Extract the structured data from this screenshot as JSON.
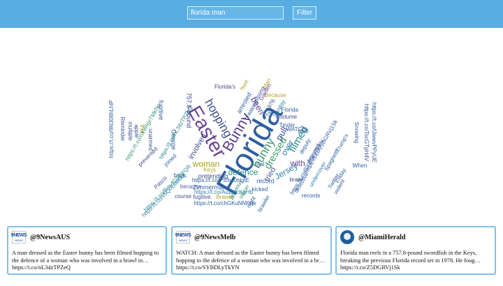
{
  "header": {
    "search_value": "florida man",
    "filter_label": "Filter",
    "bar_color": "#58aee3"
  },
  "word_cloud": {
    "words": [
      {
        "text": "Florida",
        "color": "#2f5fa0"
      },
      {
        "text": "Easter",
        "color": "#6a4495"
      },
      {
        "text": "Bunny",
        "color": "#5a3c8e"
      },
      {
        "text": "hopping",
        "color": "#3d4f8f"
      },
      {
        "text": "bunny",
        "color": "#3b9a6e"
      },
      {
        "text": "woman",
        "color": "#a1a11c"
      },
      {
        "text": "defence",
        "color": "#2a8a87"
      },
      {
        "text": "Jersey",
        "color": "#2f7fa8"
      },
      {
        "text": "filmed",
        "color": "#2a8a87"
      },
      {
        "text": "dressed",
        "color": "#3b9a6e"
      },
      {
        "text": "pull",
        "color": "#3d4f8f"
      },
      {
        "text": "tried",
        "color": "#4a5fa0"
      },
      {
        "text": "with",
        "color": "#6a4495"
      },
      {
        "text": "been",
        "color": "#5a3c8e"
      },
      {
        "text": "over",
        "color": "#2f7fa8"
      },
      {
        "text": "involved",
        "color": "#3d4f8f"
      },
      {
        "text": "pretending",
        "color": "#3d4f8f"
      },
      {
        "text": "fugitive",
        "color": "#2f5fa0"
      },
      {
        "text": "757.8-pound",
        "color": "#3b3f8f"
      },
      {
        "text": "George",
        "color": "#2f5fa0"
      },
      {
        "text": "Zimmerman",
        "color": "#2f5fa0"
      },
      {
        "text": "record",
        "color": "#2f5fa0"
      },
      {
        "text": "because",
        "color": "#5a5fa0"
      },
      {
        "text": "course",
        "color": "#3d4f8f"
      },
      {
        "text": "fugitive.",
        "color": "#3d4f8f"
      },
      {
        "text": "Brawler",
        "color": "#b0a72a"
      },
      {
        "text": "kicked",
        "color": "#2f5fa0"
      },
      {
        "text": "officer",
        "color": "#3b9a6e"
      },
      {
        "text": "night",
        "color": "#2f5fa0"
      },
      {
        "text": "brawler",
        "color": "#2f5fa0"
      },
      {
        "text": "previous",
        "color": "#2a8a87"
      },
      {
        "text": "Florida's",
        "color": "#5a3c8e"
      },
      {
        "text": "arrested",
        "color": "#2f5fa0"
      },
      {
        "text": "breaking",
        "color": "#2f5fa0"
      },
      {
        "text": "Keys",
        "color": "#b0a72a"
      },
      {
        "text": "real",
        "color": "#4a5fa0"
      },
      {
        "text": "Tinder",
        "color": "#2f5fa0"
      },
      {
        "text": "costume",
        "color": "#3d4f8f"
      },
      {
        "text": "WATCH:",
        "color": "#2f5fa0"
      },
      {
        "text": "Arrested",
        "color": "#3d4f8f"
      },
      {
        "text": "brawl",
        "color": "#3d4f8f"
      },
      {
        "text": "deputy",
        "color": "#2f5fa0"
      },
      {
        "text": "Because",
        "color": "#b0a72a"
      },
      {
        "text": "Sunday",
        "color": "#2f7fa8"
      },
      {
        "text": "1978.",
        "color": "#3d4f8f"
      },
      {
        "text": "hunt",
        "color": "#a1a11c"
      },
      {
        "text": "joined",
        "color": "#2f5fa0"
      },
      {
        "text": "Pasco",
        "color": "#3d4f8f"
      },
      {
        "text": "Twitter",
        "color": "#2f5fa0"
      },
      {
        "text": "Friday",
        "color": "#2f5fa0"
      },
      {
        "text": "Spaghetti",
        "color": "#2f5fa0"
      },
      {
        "text": "undercover",
        "color": "#2f7fa8"
      },
      {
        "text": "Trump's",
        "color": "#2f5fa0"
      },
      {
        "text": "records",
        "color": "#2f5fa0"
      },
      {
        "text": "detective",
        "color": "#2f5fa0"
      },
      {
        "text": "violent",
        "color": "#2f5fa0"
      },
      {
        "text": "Snowing",
        "color": "#2f5fa0"
      },
      {
        "text": "When",
        "color": "#2f5fa0"
      },
      {
        "text": "that",
        "color": "#b0a72a"
      },
      {
        "text": "Reminder",
        "color": "#3d4f8f"
      },
      {
        "text": "multiple",
        "color": "#3d4f8f"
      },
      {
        "text": "apple",
        "color": "#3d4f8f"
      },
      {
        "text": "unarmed",
        "color": "#3d4f8f"
      },
      {
        "text": "prevented",
        "color": "#3d4f8f"
      },
      {
        "text": "Garden",
        "color": "#5a3c8e"
      },
      {
        "text": "Man",
        "color": "#b0a72a"
      },
      {
        "text": "strong",
        "color": "#3d4f8f"
      },
      {
        "text": "Tax",
        "color": "#2f5fa0"
      },
      {
        "text": "back,",
        "color": "#2f5fa0"
      },
      {
        "text": "then",
        "color": "#2f5fa0"
      },
      {
        "text": "'Florida",
        "color": "#2f5fa0"
      },
      {
        "text": "https://t.co/9N308hLhlP",
        "color": "#2f5fa0"
      },
      {
        "text": "https://t.co/nL34zTPZeQ",
        "color": "#2a8a87"
      },
      {
        "text": "https://t.co/P53uf0HgtE",
        "color": "#2f5fa0"
      },
      {
        "text": "https://t.co/AuZxIcKgHb",
        "color": "#2f7fa8"
      },
      {
        "text": "https://t.co/chGKuNM0qe",
        "color": "#2f5fa0"
      },
      {
        "text": "https://t.co/nXWIgzTMkPq",
        "color": "#3b9a6e"
      },
      {
        "text": "https://t.co/SYBDLyTkYN",
        "color": "#2f5fa0"
      },
      {
        "text": "https://t.co/BmyfGSBYQR",
        "color": "#2a8a87"
      },
      {
        "text": "https://t.co/v5Q0UiM6k5",
        "color": "#2f7fa8"
      },
      {
        "text": "https://t.co/lJwwvPPyUE",
        "color": "#2f5fa0"
      },
      {
        "text": "https://t.co/z5DGRVj1Sk",
        "color": "#2f5fa0"
      },
      {
        "text": "https://t.co/TscGTpH4V",
        "color": "#2f5fa0"
      }
    ]
  },
  "cards": [
    {
      "handle": "@9NewsAUS",
      "logo_top": "9NEWS",
      "logo_bottom": "NEWS",
      "text": "A man dressed as the Easter bunny has been filmed hopping to the defence of a woman who was involved in a brawl in… https://t.co/nL34zTPZeQ"
    },
    {
      "handle": "@9NewsMelb",
      "logo_top": "9NEWS",
      "logo_bottom": "NEWS",
      "text": "WATCH: A man dressed as the Easter bunny has been filmed hopping to the defence of a woman who was involved in a br… https://t.co/SYBDLyTkYN"
    },
    {
      "handle": "@MiamiHerald",
      "text": "Florida man reels in a 757.8-pound swordfish in the Keys, breaking the previous Florida record set in 1978. He foug… https://t.co/Z5DGRVj1Sk"
    }
  ]
}
